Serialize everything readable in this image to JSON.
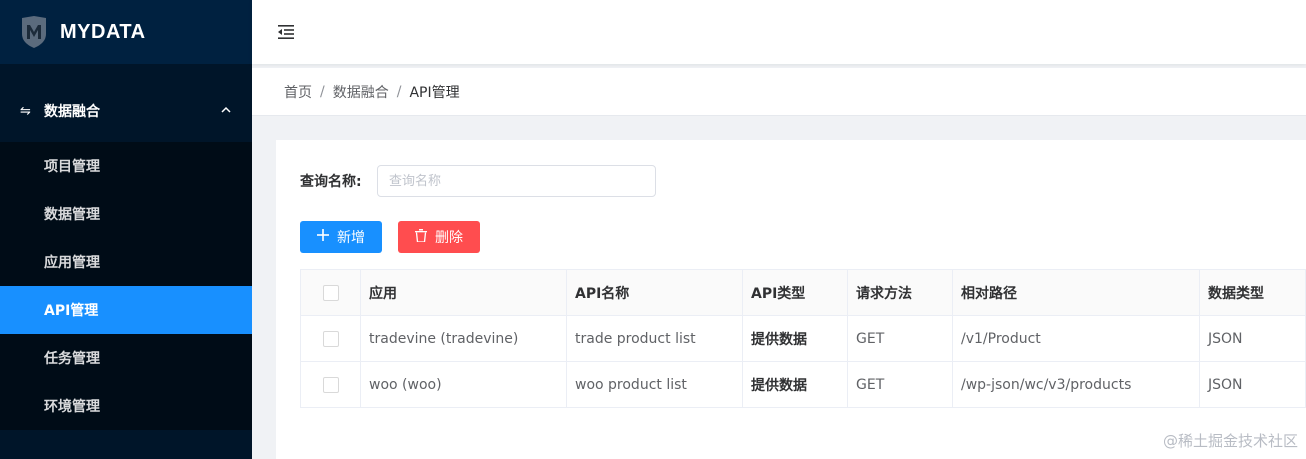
{
  "app": {
    "title": "MYDATA"
  },
  "sidebar": {
    "group": {
      "label": "数据融合",
      "icon": "swap-arrows-icon"
    },
    "items": [
      {
        "label": "项目管理",
        "active": false
      },
      {
        "label": "数据管理",
        "active": false
      },
      {
        "label": "应用管理",
        "active": false
      },
      {
        "label": "API管理",
        "active": true
      },
      {
        "label": "任务管理",
        "active": false
      },
      {
        "label": "环境管理",
        "active": false
      }
    ]
  },
  "breadcrumb": {
    "items": [
      "首页",
      "数据融合",
      "API管理"
    ],
    "separator": "/"
  },
  "query": {
    "label": "查询名称:",
    "placeholder": "查询名称",
    "value": ""
  },
  "toolbar": {
    "add_label": "新增",
    "delete_label": "删除"
  },
  "table": {
    "headers": [
      "应用",
      "API名称",
      "API类型",
      "请求方法",
      "相对路径",
      "数据类型"
    ],
    "rows": [
      [
        "tradevine (tradevine)",
        "trade product list",
        "提供数据",
        "GET",
        "/v1/Product",
        "JSON"
      ],
      [
        "woo (woo)",
        "woo product list",
        "提供数据",
        "GET",
        "/wp-json/wc/v3/products",
        "JSON"
      ]
    ]
  },
  "watermark": "@稀土掘金技术社区",
  "colors": {
    "sidebar_bg": "#001529",
    "primary": "#1890ff",
    "danger": "#ff4d4f"
  }
}
